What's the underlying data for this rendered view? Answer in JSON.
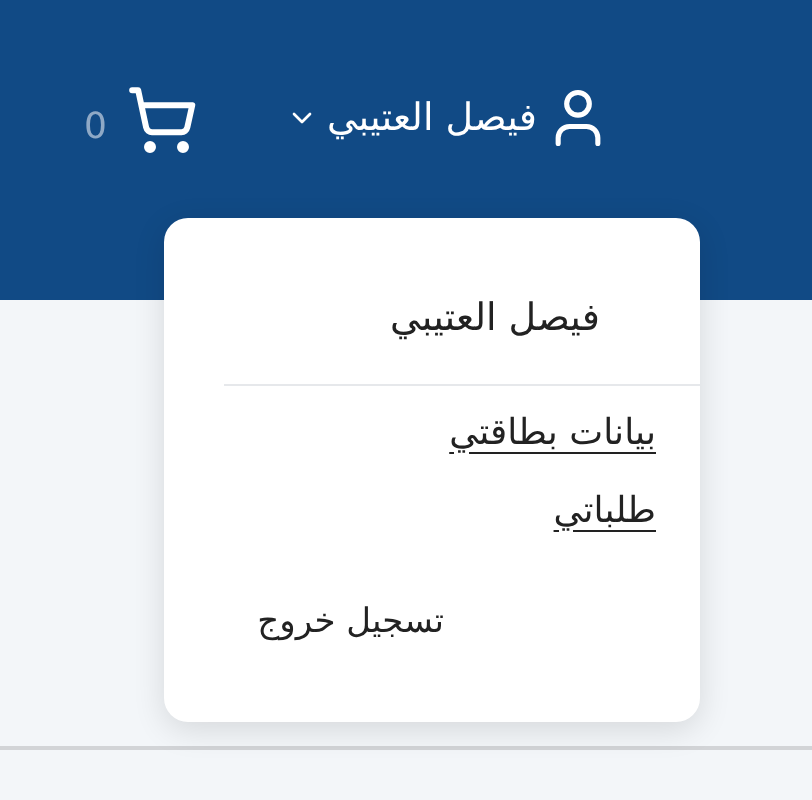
{
  "header": {
    "cart_count": "0",
    "user_name": "فيصل العتيبي"
  },
  "user_menu": {
    "title": "فيصل العتيبي",
    "items": [
      {
        "label": "بيانات بطاقتي",
        "kind": "link"
      },
      {
        "label": "طلباتي",
        "kind": "link"
      },
      {
        "label": "تسجيل خروج",
        "kind": "action"
      }
    ]
  }
}
